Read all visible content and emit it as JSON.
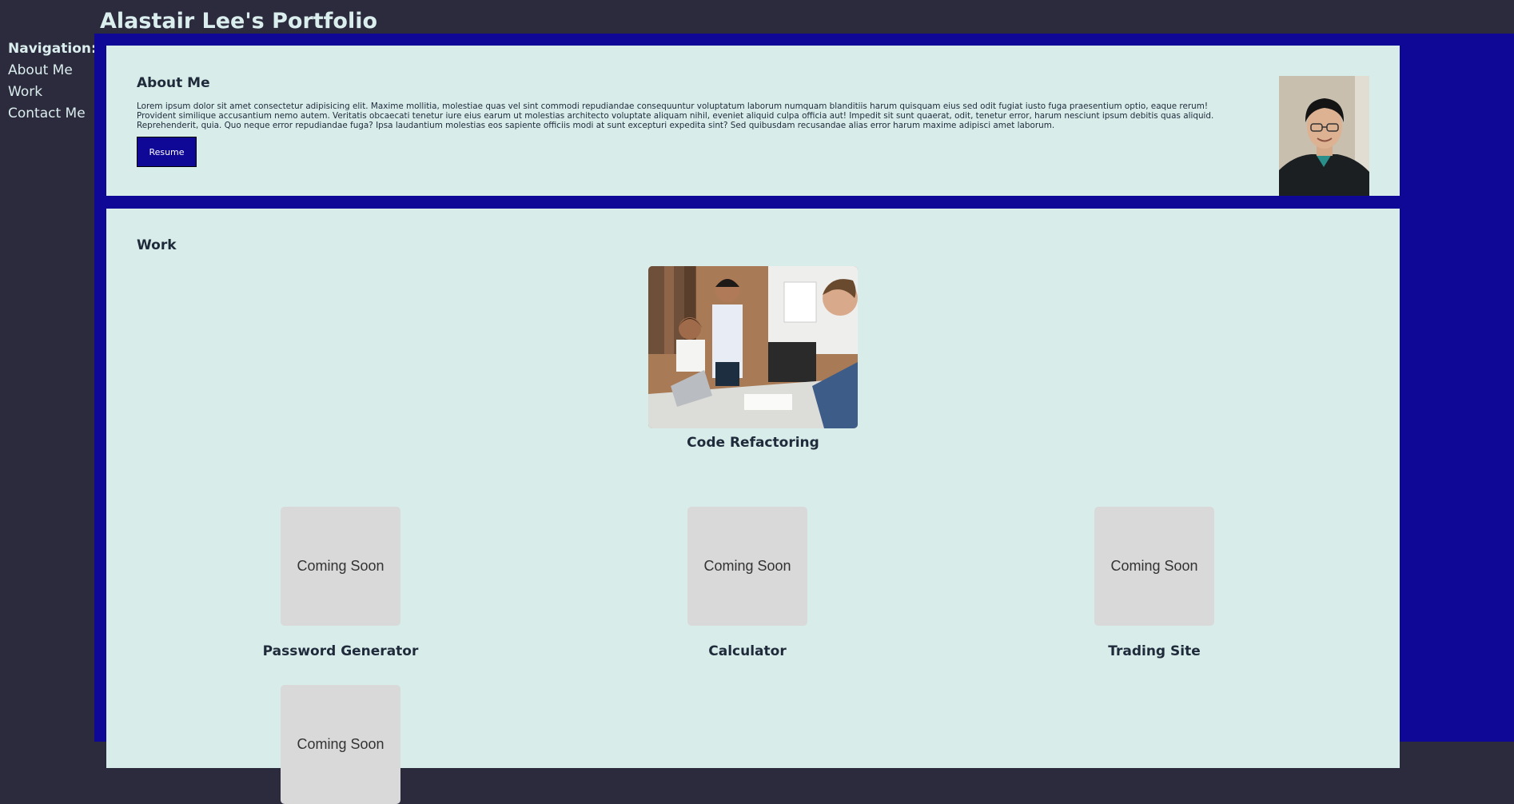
{
  "header": {
    "title": "Alastair Lee's Portfolio"
  },
  "nav": {
    "heading": "Navigation:",
    "items": [
      "About Me",
      "Work",
      "Contact Me"
    ]
  },
  "about": {
    "heading": "About Me",
    "body": "Lorem ipsum dolor sit amet consectetur adipisicing elit. Maxime mollitia, molestiae quas vel sint commodi repudiandae consequuntur voluptatum laborum numquam blanditiis harum quisquam eius sed odit fugiat iusto fuga praesentium optio, eaque rerum! Provident similique accusantium nemo autem. Veritatis obcaecati tenetur iure eius earum ut molestias architecto voluptate aliquam nihil, eveniet aliquid culpa officia aut! Impedit sit sunt quaerat, odit, tenetur error, harum nesciunt ipsum debitis quas aliquid. Reprehenderit, quia. Quo neque error repudiandae fuga? Ipsa laudantium molestias eos sapiente officiis modi at sunt excepturi expedita sint? Sed quibusdam recusandae alias error harum maxime adipisci amet laborum.",
    "button_label": "Resume"
  },
  "work": {
    "heading": "Work",
    "featured": {
      "title": "Code Refactoring"
    },
    "placeholder_text": "Coming Soon",
    "projects": [
      {
        "title": "Password Generator",
        "tile_text": "Coming Soon"
      },
      {
        "title": "Calculator",
        "tile_text": "Coming Soon"
      },
      {
        "title": "Trading Site",
        "tile_text": "Coming Soon"
      },
      {
        "title": "",
        "tile_text": "Coming Soon"
      }
    ]
  },
  "colors": {
    "page_background": "#2c2a3d",
    "main_background": "#0f0795",
    "card_background": "#d8ecea",
    "header_text": "#dbeeee",
    "body_text": "#1f2a3a",
    "placeholder_tile": "#d9d9d9"
  }
}
